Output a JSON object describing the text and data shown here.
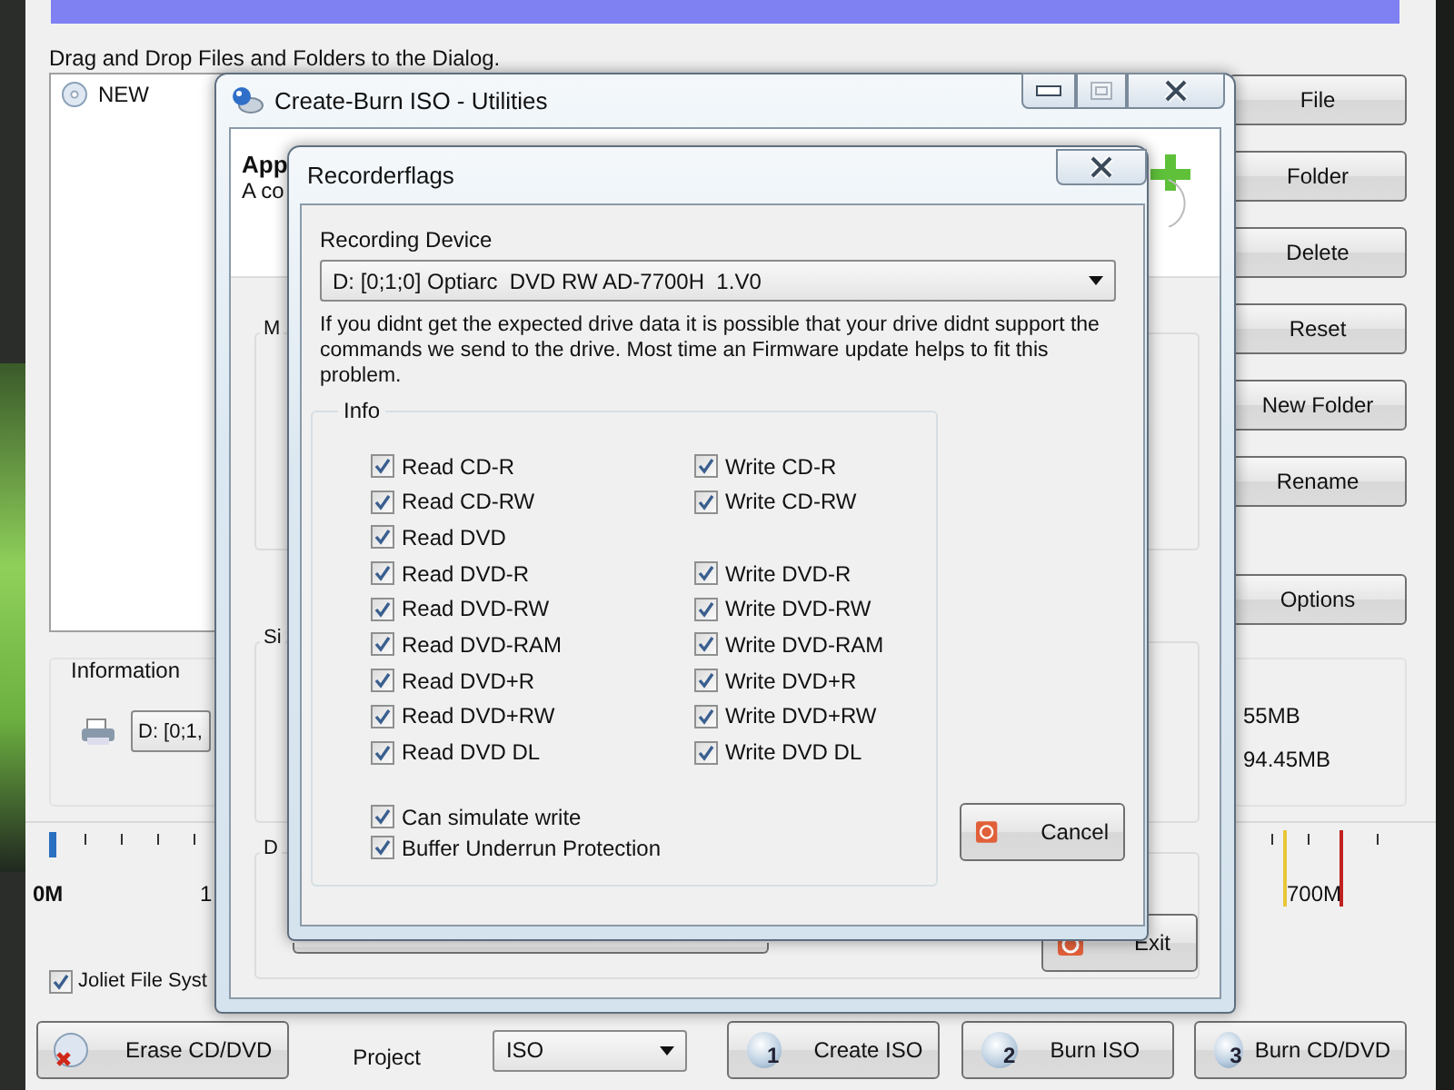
{
  "main_window": {
    "instruction": "Drag and Drop Files and Folders to the Dialog.",
    "tree": [
      {
        "label": "NEW"
      }
    ],
    "side_buttons": [
      "File",
      "Folder",
      "Delete",
      "Reset",
      "New Folder",
      "Rename",
      "Options"
    ],
    "information": {
      "title": "Information",
      "device": "D: [0;1,",
      "sizes": [
        "55MB",
        "94.45MB"
      ]
    },
    "scale_labels": [
      "0M",
      "1",
      "700M"
    ],
    "joliet": {
      "label": "Joliet File Syst",
      "checked": true
    },
    "erase_button": "Erase CD/DVD",
    "project_label": "Project",
    "project": "ISO",
    "steps": [
      {
        "number": "1",
        "label": "Create ISO"
      },
      {
        "number": "2",
        "label": "Burn ISO"
      },
      {
        "number": "3",
        "label": "Burn CD/DVD"
      }
    ]
  },
  "utilities_window": {
    "title": "Create-Burn ISO - Utilities",
    "heading": "App",
    "description": "A co",
    "group_labels": [
      "M",
      "Si",
      "D"
    ],
    "exit_button": "Exit",
    "caption_buttons": [
      {
        "kind": "minimize",
        "disabled": false
      },
      {
        "kind": "maximize",
        "disabled": true
      },
      {
        "kind": "close",
        "disabled": false
      }
    ]
  },
  "recorder_dialog": {
    "title": "Recorderflags",
    "device_label": "Recording Device",
    "device": "D: [0;1;0] Optiarc  DVD RW AD-7700H  1.V0",
    "note": "If you didnt get the expected drive data it is possible that your drive didnt support the commands we send to the drive. Most time an Firmware update helps to fit this problem.",
    "info_title": "Info",
    "rows": [
      {
        "read": {
          "label": "Read CD-R",
          "checked": true
        },
        "write": {
          "label": "Write CD-R",
          "checked": true
        }
      },
      {
        "read": {
          "label": "Read CD-RW",
          "checked": true
        },
        "write": {
          "label": "Write CD-RW",
          "checked": true
        }
      },
      {
        "read": {
          "label": "Read DVD",
          "checked": true
        }
      },
      {
        "read": {
          "label": "Read DVD-R",
          "checked": true
        },
        "write": {
          "label": "Write DVD-R",
          "checked": true
        }
      },
      {
        "read": {
          "label": "Read DVD-RW",
          "checked": true
        },
        "write": {
          "label": "Write DVD-RW",
          "checked": true
        }
      },
      {
        "read": {
          "label": "Read DVD-RAM",
          "checked": true
        },
        "write": {
          "label": "Write DVD-RAM",
          "checked": true
        }
      },
      {
        "read": {
          "label": "Read DVD+R",
          "checked": true
        },
        "write": {
          "label": "Write DVD+R",
          "checked": true
        }
      },
      {
        "read": {
          "label": "Read DVD+RW",
          "checked": true
        },
        "write": {
          "label": "Write DVD+RW",
          "checked": true
        }
      },
      {
        "read": {
          "label": "Read DVD DL",
          "checked": true
        },
        "write": {
          "label": "Write DVD DL",
          "checked": true
        }
      }
    ],
    "extras": [
      {
        "label": "Can simulate write",
        "checked": true
      },
      {
        "label": "Buffer Underrun Protection",
        "checked": true
      }
    ],
    "cancel_button": "Cancel"
  }
}
